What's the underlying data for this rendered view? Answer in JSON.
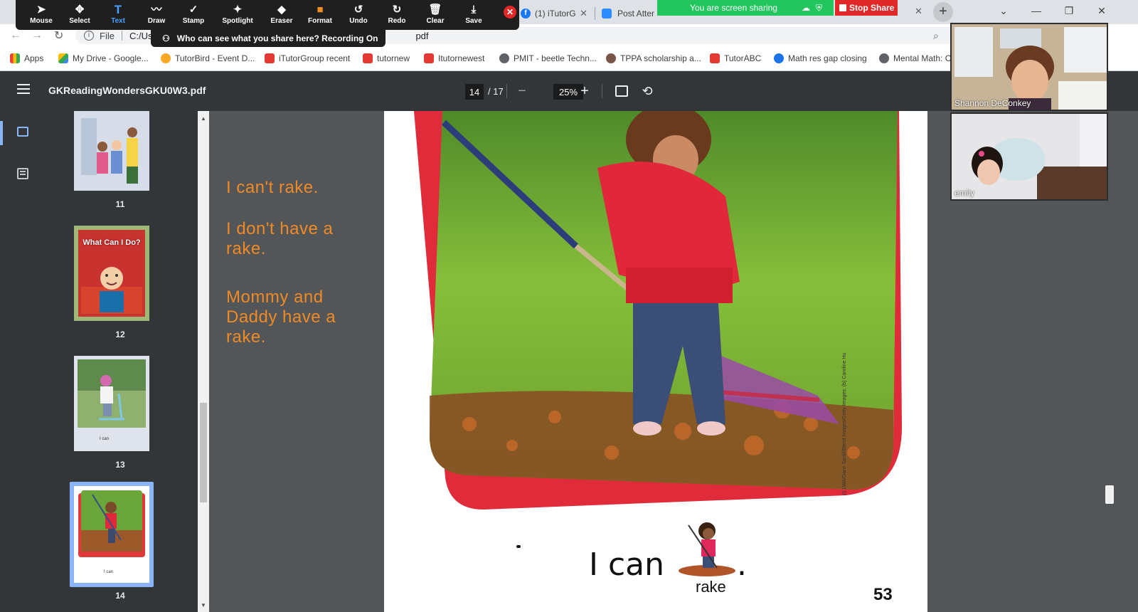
{
  "browser": {
    "tabs": [
      {
        "label": "(1) iTutorG"
      },
      {
        "label": "Post Atter"
      }
    ],
    "url_prefix": "File",
    "url_path": "C:/Us",
    "url_suffix": "pdf",
    "bookmarks": [
      {
        "label": "Apps"
      },
      {
        "label": "My Drive - Google..."
      },
      {
        "label": "TutorBird - Event D..."
      },
      {
        "label": "iTutorGroup recent"
      },
      {
        "label": "tutornew"
      },
      {
        "label": "Itutornewest"
      },
      {
        "label": "PMIT - beetle Techn..."
      },
      {
        "label": "TPPA scholarship a..."
      },
      {
        "label": "TutorABC"
      },
      {
        "label": "Math res gap closing"
      },
      {
        "label": "Mental Math: C"
      }
    ]
  },
  "zoom": {
    "tools": [
      {
        "label": "Mouse",
        "glyph": "➤"
      },
      {
        "label": "Select",
        "glyph": "✥"
      },
      {
        "label": "Text",
        "glyph": "T"
      },
      {
        "label": "Draw",
        "glyph": "〰"
      },
      {
        "label": "Stamp",
        "glyph": "✓"
      },
      {
        "label": "Spotlight",
        "glyph": "✦"
      },
      {
        "label": "Eraser",
        "glyph": "◆"
      },
      {
        "label": "Format",
        "glyph": "■"
      },
      {
        "label": "Undo",
        "glyph": "↺"
      },
      {
        "label": "Redo",
        "glyph": "↻"
      },
      {
        "label": "Clear",
        "glyph": "🗑"
      },
      {
        "label": "Save",
        "glyph": "⤓"
      }
    ],
    "recording_notice": "Who can see what you share here? Recording On",
    "sharing_status": "You are screen sharing",
    "stop_share": "Stop Share"
  },
  "pdf": {
    "filename": "GKReadingWondersGKU0W3.pdf",
    "current_page": "14",
    "total_pages": "/ 17",
    "zoom": "25%",
    "thumbnails": [
      {
        "num": "11"
      },
      {
        "num": "12",
        "cover_title": "What Can I Do?"
      },
      {
        "num": "13",
        "caption": "I can"
      },
      {
        "num": "14",
        "caption": "I can",
        "selected": true
      }
    ],
    "story_lines": [
      "I can't rake.",
      "I don't have a rake.",
      "Mommy and Daddy have a rake."
    ],
    "page_text": "I can",
    "page_period": ".",
    "rebus_word": "rake",
    "page_number": "53",
    "credit": "(t) LWA/Dann Tardif/Blend Images/Getty Images; (b) Caroline Hu"
  },
  "participants": [
    {
      "name": "Shannon DeConkey"
    },
    {
      "name": "emily"
    }
  ],
  "colors": {
    "story_text": "#f08a24",
    "pdf_toolbar": "#323639",
    "stop_share": "#e02828",
    "sharing_green": "#22c55e"
  }
}
